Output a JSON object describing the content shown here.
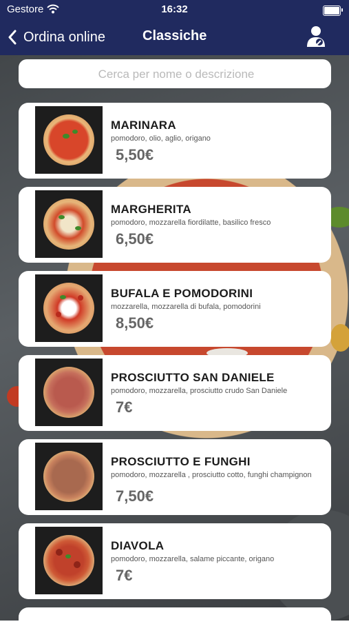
{
  "status_bar": {
    "carrier": "Gestore",
    "time": "16:32"
  },
  "nav": {
    "back_label": "Ordina online",
    "title": "Classiche"
  },
  "search": {
    "placeholder": "Cerca per nome o descrizione",
    "value": ""
  },
  "items": [
    {
      "name": "MARINARA",
      "description": "pomodoro, olio, aglio, origano",
      "price": "5,50€"
    },
    {
      "name": "MARGHERITA",
      "description": "pomodoro, mozzarella fiordilatte, basilico fresco",
      "price": "6,50€"
    },
    {
      "name": "BUFALA E POMODORINI",
      "description": "mozzarella, mozzarella di bufala, pomodorini",
      "price": "8,50€"
    },
    {
      "name": "PROSCIUTTO SAN DANIELE",
      "description": "pomodoro, mozzarella, prosciutto crudo San Daniele",
      "price": "7€"
    },
    {
      "name": "PROSCIUTTO E FUNGHI",
      "description": "pomodoro, mozzarella , prosciutto cotto, funghi champignon",
      "price": "7,50€"
    },
    {
      "name": "DIAVOLA",
      "description": "pomodoro, mozzarella, salame piccante, origano",
      "price": "7€"
    }
  ],
  "colors": {
    "nav_background": "#202a5f",
    "card_background": "#ffffff",
    "price_text": "#666666"
  }
}
